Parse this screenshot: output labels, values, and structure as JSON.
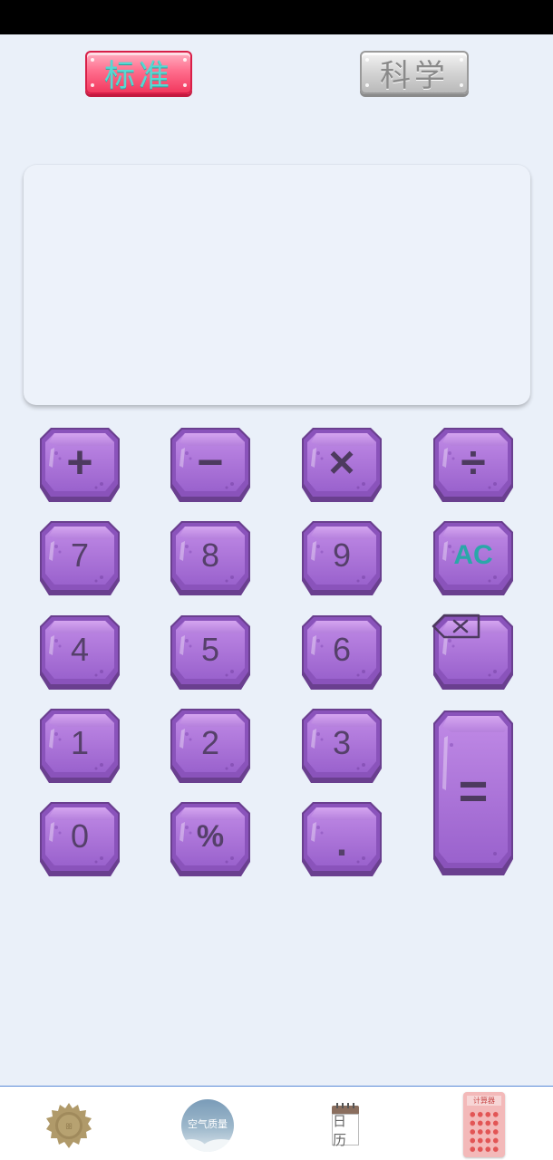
{
  "modes": {
    "standard_label": "标准",
    "science_label": "科学",
    "active": "standard"
  },
  "display": {
    "expression": "",
    "result": ""
  },
  "keys": {
    "plus": "+",
    "minus": "−",
    "multiply": "×",
    "divide": "÷",
    "seven": "7",
    "eight": "8",
    "nine": "9",
    "clear": "AC",
    "four": "4",
    "five": "5",
    "six": "6",
    "backspace_icon": "backspace-icon",
    "one": "1",
    "two": "2",
    "three": "3",
    "equals": "=",
    "zero": "0",
    "percent": "%",
    "dot": "."
  },
  "nav": {
    "item1_icon": "gear-badge-icon",
    "air_quality_label": "空气质量",
    "calendar_label": "日历",
    "calculator_label": "计算器"
  },
  "colors": {
    "background": "#eaf0f9",
    "key_gem": "#a872d2",
    "active_tab": "#f2385e",
    "accent_teal": "#2aa7a9"
  }
}
